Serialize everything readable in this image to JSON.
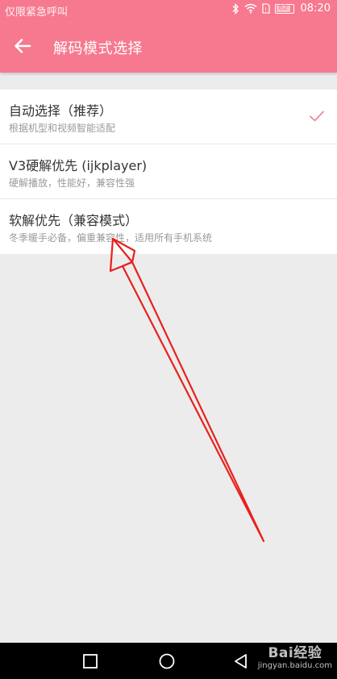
{
  "status_bar": {
    "carrier_text": "仅限紧急呼叫",
    "battery_level": "82",
    "time": "08:20"
  },
  "app_bar": {
    "title": "解码模式选择",
    "back_icon": "arrow-left-icon"
  },
  "options": [
    {
      "title": "自动选择（推荐）",
      "description": "根据机型和视频智能适配",
      "selected": true
    },
    {
      "title": "V3硬解优先 (ijkplayer)",
      "description": "硬解播放，性能好，兼容性强",
      "selected": false
    },
    {
      "title": "软解优先（兼容模式）",
      "description": "冬季暖手必备，偏重兼容性，适用所有手机系统",
      "selected": false
    }
  ],
  "annotation": {
    "type": "red-arrow",
    "points_to": "软解优先（兼容模式）"
  },
  "nav_bar": {
    "recent_icon": "square-icon",
    "home_icon": "circle-icon",
    "back_icon": "triangle-back-icon"
  },
  "watermark": {
    "logo": "Bai经验",
    "url": "jingyan.baidu.com"
  },
  "colors": {
    "accent": "#f7798f",
    "background": "#ececec",
    "arrow": "#e8211c",
    "check": "#f0879a"
  }
}
